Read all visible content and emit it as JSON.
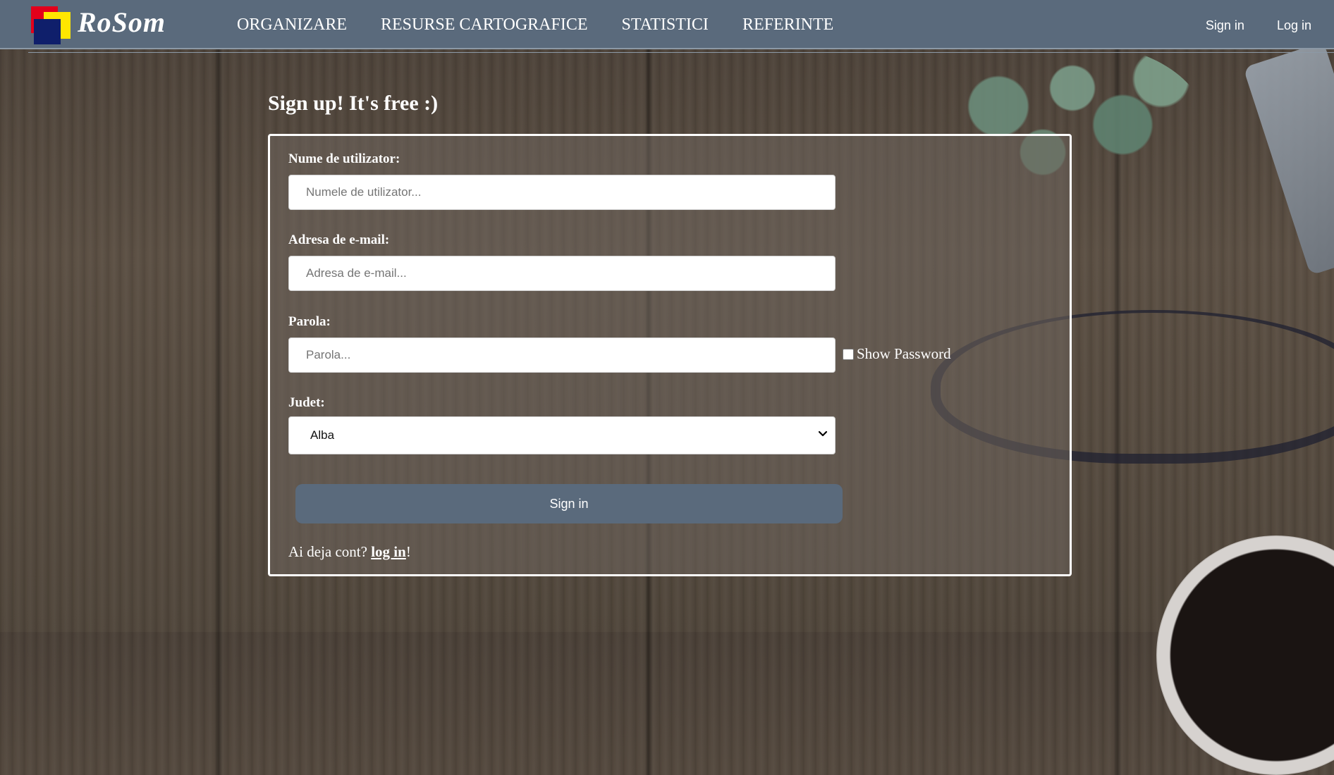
{
  "brand": {
    "name": "RoSom"
  },
  "nav": {
    "links": [
      "ORGANIZARE",
      "RESURSE CARTOGRAFICE",
      "STATISTICI",
      "REFERINTE"
    ],
    "sign_in": "Sign in",
    "log_in": "Log in"
  },
  "page": {
    "title": "Sign up! It's free :)"
  },
  "form": {
    "username": {
      "label": "Nume de utilizator:",
      "placeholder": "Numele de utilizator..."
    },
    "email": {
      "label": "Adresa de e-mail:",
      "placeholder": "Adresa de e-mail..."
    },
    "password": {
      "label": "Parola:",
      "placeholder": "Parola...",
      "show_label": "Show Password"
    },
    "county": {
      "label": "Judet:",
      "selected": "Alba"
    },
    "submit_label": "Sign in",
    "footer": {
      "prefix": "Ai deja cont? ",
      "link": "log in",
      "suffix": "!"
    }
  },
  "colors": {
    "navbar": "#5a6a7c",
    "logo_red": "#e3001b",
    "logo_yellow": "#ffe600",
    "logo_blue": "#0f1f6b"
  }
}
